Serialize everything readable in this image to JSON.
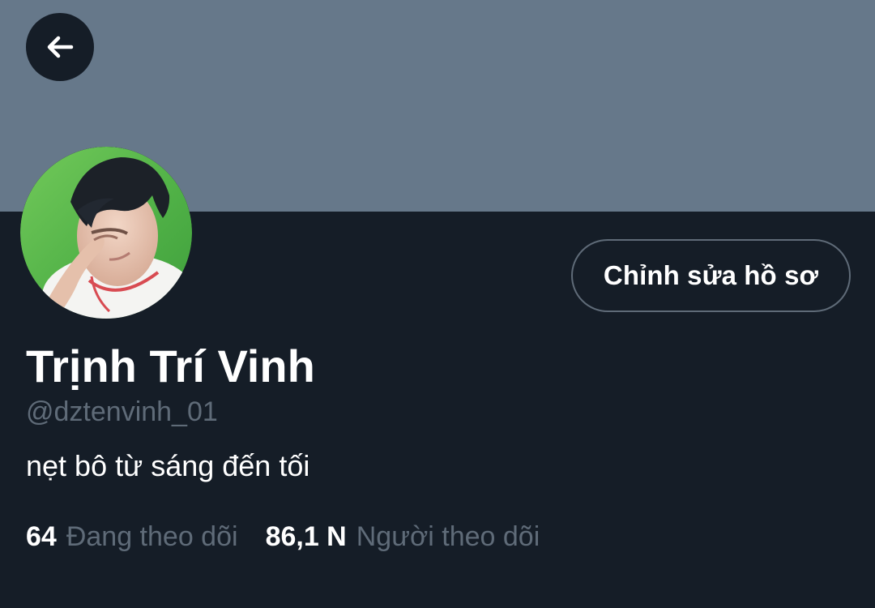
{
  "header": {
    "back_icon": "arrow-left-icon",
    "banner_color": "#66788a"
  },
  "profile": {
    "avatar_description": "profile photo",
    "edit_button_label": "Chỉnh sửa hồ sơ",
    "display_name": "Trịnh Trí Vinh",
    "username": "@dztenvinh_01",
    "bio": "nẹt bô từ sáng đến tối",
    "following_count": "64",
    "following_label": "Đang theo dõi",
    "followers_count": "86,1 N",
    "followers_label": "Người theo dõi"
  },
  "theme": {
    "background": "#151d27",
    "text": "#ffffff",
    "muted_text": "#5f6b78",
    "button_border": "#5f6b78"
  }
}
